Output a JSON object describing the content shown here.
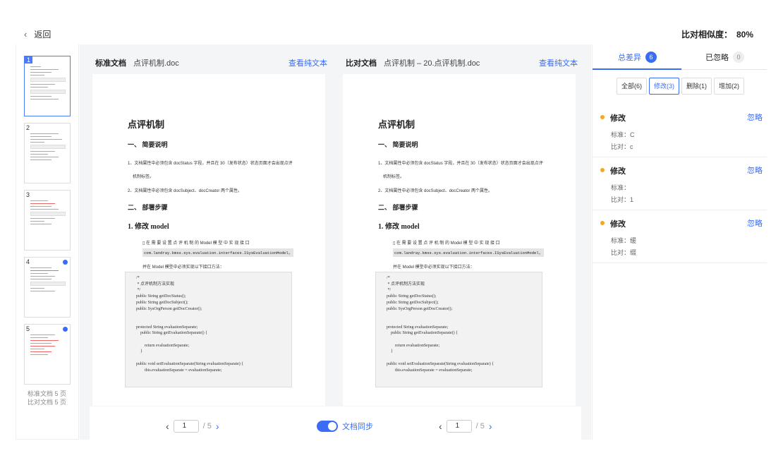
{
  "header": {
    "back_label": "返回",
    "similarity_label": "比对相似度：",
    "similarity_value": "80%"
  },
  "thumbnails": {
    "pages": [
      "1",
      "2",
      "3",
      "4",
      "5"
    ],
    "summary_standard": "标准文档 5 页",
    "summary_compare": "比对文档 5 页"
  },
  "standard_doc": {
    "label": "标准文档",
    "filename": "点评机制.doc",
    "plain_text_link": "查看纯文本"
  },
  "compare_doc": {
    "label": "比对文档",
    "filename": "点评机制 – 20.点评机制.doc",
    "plain_text_link": "查看纯文本"
  },
  "doc_content": {
    "title": "点评机制",
    "section1": "一、 简要说明",
    "item1": "1、文档属性中必须包含 docStatus 字段，并且在 30（发布状态）状态页面才会出现点评",
    "item1_cont": "机制标签。",
    "item2": "2、文档属性中必须包含 docSubject、docCreator 两个属性。",
    "section2": "二、 部署步骤",
    "step1": "1. 修改 model",
    "step1_text": "▯  在 需 要 设 置 点 评 机 制 的  Model  模 型 中 实 现 接 口",
    "interface": "com.landray.kmss.sys.evaluation.interfaces.ISysEvaluationModel，",
    "step1_text2": "并在 Model 模型中必须实现以下接口方法：",
    "code": "/*\n * 点评机制方法实现\n */\npublic String getDocStatus();\npublic String getDocSubject();\npublic SysOrgPerson getDocCreator();\n\n\nprotected String evaluationSeparate;\n    public String getEvaluationSeparate() {\n\n        return evaluationSeparate;\n    }\n\npublic void setEvaluationSeparate(String evaluationSeparate) {\n        this.evaluationSeparate = evaluationSeparate;"
  },
  "pager": {
    "prev": "‹",
    "next": "›",
    "left_page": "1",
    "left_total": "/ 5",
    "right_page": "1",
    "right_total": "/ 5",
    "sync_label": "文档同步"
  },
  "right_panel": {
    "tab_total": "总差异",
    "tab_total_count": "6",
    "tab_ignored": "已忽略",
    "tab_ignored_count": "0",
    "filters": [
      "全部(6)",
      "修改(3)",
      "删除(1)",
      "增加(2)"
    ],
    "diffs": [
      {
        "title": "修改",
        "ignore": "忽略",
        "standard": "标准：C",
        "compare": "比对：c"
      },
      {
        "title": "修改",
        "ignore": "忽略",
        "standard": "标准：",
        "compare": "比对：1"
      },
      {
        "title": "修改",
        "ignore": "忽略",
        "standard": "标准：缓",
        "compare": "比对：缀"
      }
    ]
  },
  "colors": {
    "accent": "#3b6cf6",
    "modify_dot": "#f5a623"
  }
}
